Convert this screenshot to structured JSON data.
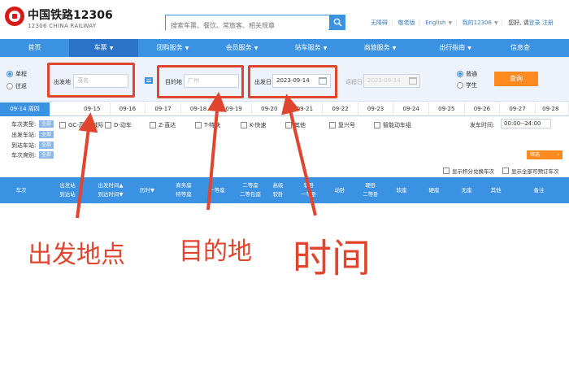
{
  "header": {
    "brand": "中国铁路12306",
    "brand_sub": "12306 CHINA RAILWAY",
    "search_placeholder": "搜索车票、餐饮、常旅客、相关规章",
    "links": [
      "无障碍",
      "敬老版",
      "English",
      "我的12306"
    ],
    "greeting": "您好, 请",
    "login": "登录",
    "register": "注册"
  },
  "nav": {
    "items": [
      "首页",
      "车票",
      "团购服务",
      "会员服务",
      "站车服务",
      "商旅服务",
      "出行指南",
      "信息查"
    ]
  },
  "query": {
    "trip_types": [
      "单程",
      "往返"
    ],
    "from_label": "出发地",
    "from_placeholder": "茂名",
    "to_label": "目的地",
    "to_placeholder": "广州",
    "depart_label": "出发日",
    "depart_value": "2023-09-14",
    "return_label": "返程日",
    "return_value": "2023-09-14",
    "ticket_types": [
      "普通",
      "学生"
    ],
    "query_button": "查询"
  },
  "dates": [
    "09-14 周四",
    "09-15",
    "09-16",
    "09-17",
    "09-18",
    "09-19",
    "09-20",
    "09-21",
    "09-22",
    "09-23",
    "09-24",
    "09-25",
    "09-26",
    "09-27",
    "09-28"
  ],
  "filter": {
    "row_labels": [
      "车次类型:",
      "出发车站:",
      "到达车站:",
      "车次席别:"
    ],
    "all_label": "全部",
    "train_types": [
      "GC-高铁/城际",
      "D-动车",
      "Z-直达",
      "T-特快",
      "K-快速",
      "其他",
      "复兴号",
      "智能动车组"
    ],
    "depart_time_label": "发车时间:",
    "depart_time_value": "00:00--24:00",
    "filter_button": "筛选",
    "option_points": "显示积分兑换车次",
    "option_all": "显示全部可预订车次"
  },
  "table_header": {
    "columns": [
      [
        "车次"
      ],
      [
        "出发站",
        "到达站"
      ],
      [
        "出发时间▲",
        "到达时间▼"
      ],
      [
        "历时▼"
      ],
      [
        "商务座",
        "特等座"
      ],
      [
        "一等座"
      ],
      [
        "二等座",
        "二等包座"
      ],
      [
        "高级",
        "软卧"
      ],
      [
        "软卧",
        "一等卧"
      ],
      [
        "动卧"
      ],
      [
        "硬卧",
        "二等卧"
      ],
      [
        "软座"
      ],
      [
        "硬座"
      ],
      [
        "无座"
      ],
      [
        "其他"
      ],
      [
        "备注"
      ]
    ]
  },
  "annotations": {
    "origin": "出发地点",
    "destination": "目的地",
    "time": "时间",
    "color": "#e0462f"
  }
}
